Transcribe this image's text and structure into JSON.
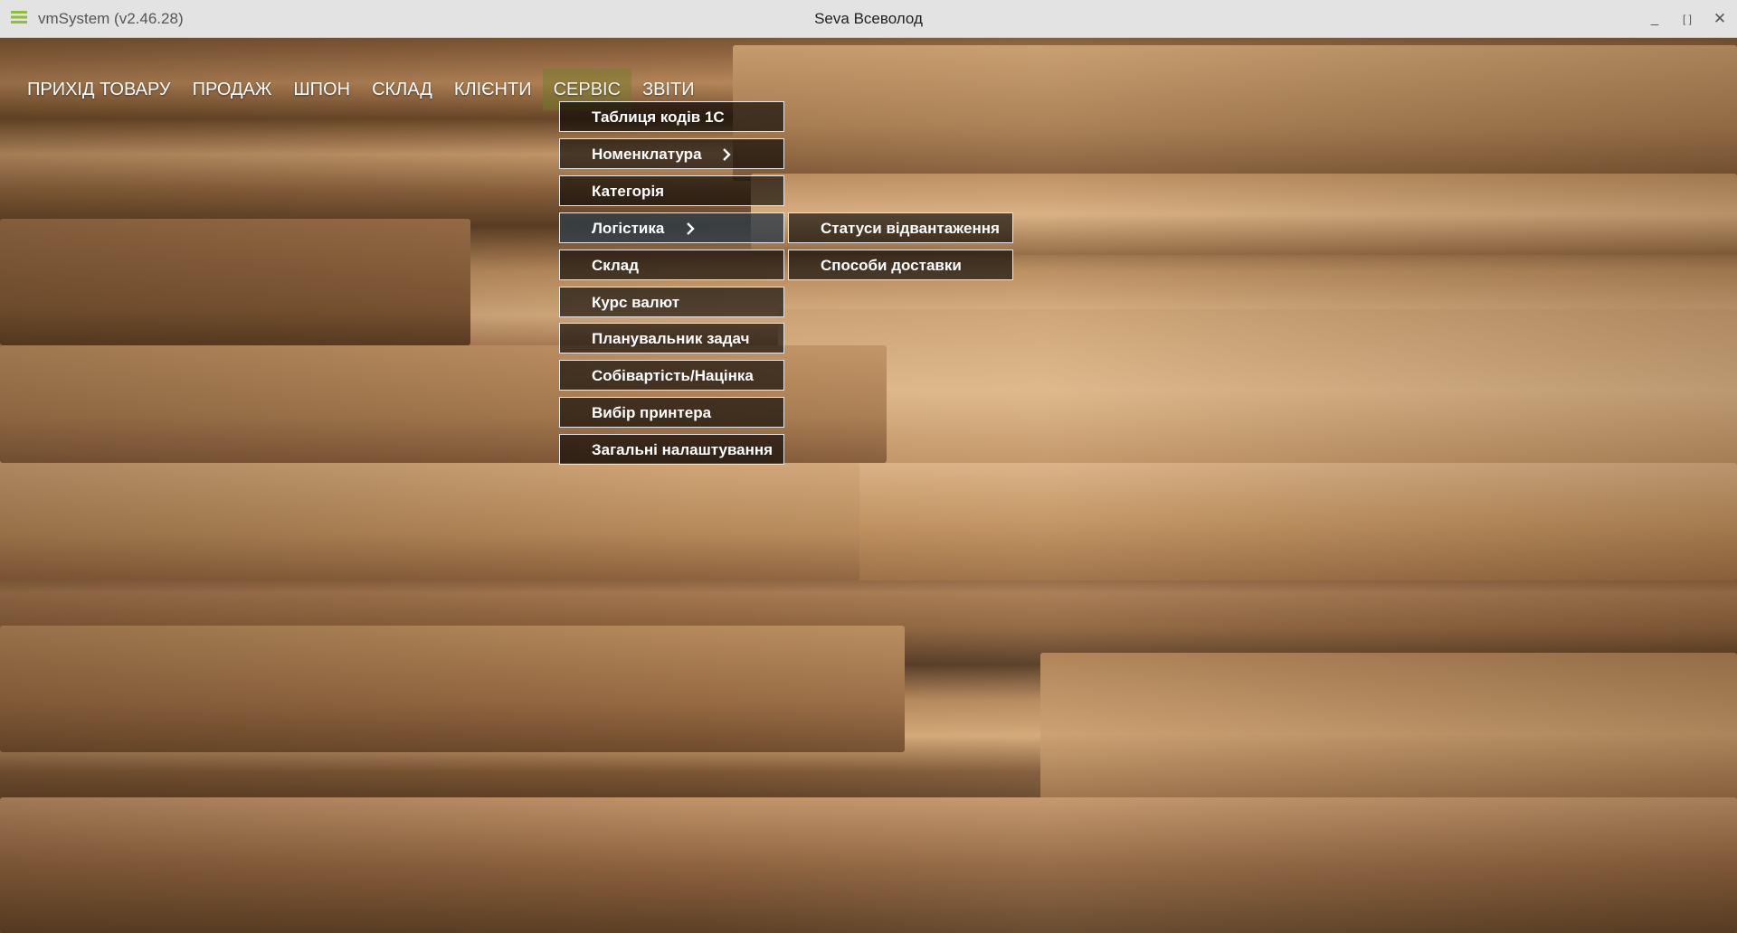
{
  "window": {
    "app_title": "vmSystem (v2.46.28)",
    "user": "Seva Всеволод",
    "minimize_glyph": "_",
    "maximize_glyph": "[ ]",
    "close_glyph": "✕"
  },
  "menu": {
    "items": [
      {
        "label": "ПРИХІД ТОВАРУ"
      },
      {
        "label": "ПРОДАЖ"
      },
      {
        "label": "ШПОН"
      },
      {
        "label": "СКЛАД"
      },
      {
        "label": "КЛІЄНТИ"
      },
      {
        "label": "СЕРВІС"
      },
      {
        "label": "ЗВІТИ"
      }
    ],
    "active": "СЕРВІС"
  },
  "service_menu": {
    "items": [
      {
        "label": "Таблиця кодів 1С"
      },
      {
        "label": "Номенклатура",
        "has_submenu": true
      },
      {
        "label": "Категорія"
      },
      {
        "label": "Логістика",
        "has_submenu": true,
        "hovered": true
      },
      {
        "label": "Склад"
      },
      {
        "label": "Курс валют"
      },
      {
        "label": "Планувальник задач"
      },
      {
        "label": "Собівартість/Націнка"
      },
      {
        "label": "Вибір принтера"
      },
      {
        "label": "Загальні налаштування"
      }
    ]
  },
  "logistics_submenu": {
    "items": [
      {
        "label": "Статуси відвантаження"
      },
      {
        "label": "Способи доставки"
      }
    ]
  },
  "icons": {
    "app": "app-menu-icon",
    "submenu": "chevron-right-icon"
  },
  "colors": {
    "titlebar": "#e3e3e3",
    "active_menu": "#6e7d28",
    "dropdown_bg": "#000000",
    "dropdown_border": "#e8e8e8"
  }
}
